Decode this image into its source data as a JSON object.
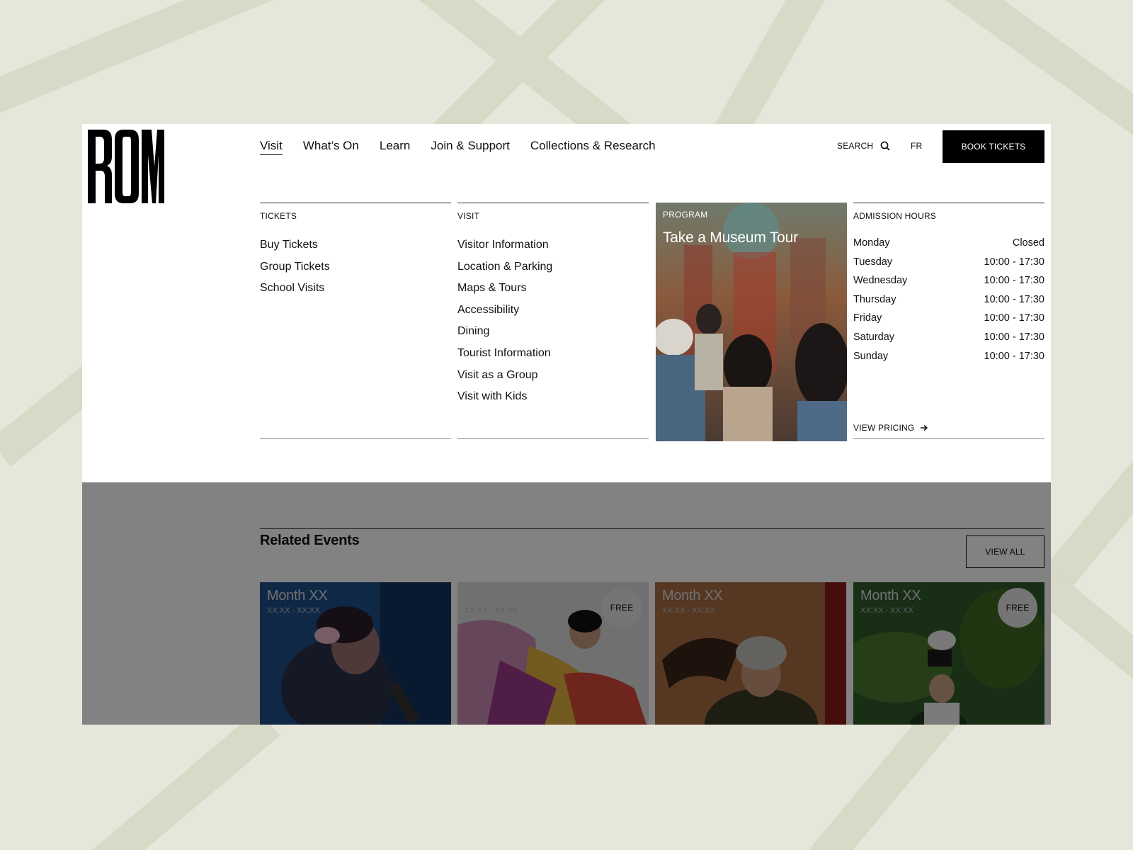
{
  "brand": {
    "logo_text": "ROM"
  },
  "nav": {
    "items": [
      {
        "label": "Visit",
        "active": true
      },
      {
        "label": "What’s On"
      },
      {
        "label": "Learn"
      },
      {
        "label": "Join & Support"
      },
      {
        "label": "Collections & Research"
      }
    ],
    "search_label": "SEARCH",
    "lang_label": "FR",
    "book_label": "BOOK TICKETS"
  },
  "menu": {
    "tickets": {
      "heading": "TICKETS",
      "links": [
        "Buy Tickets",
        "Group Tickets",
        "School Visits"
      ]
    },
    "visit": {
      "heading": "VISIT",
      "links": [
        "Visitor Information",
        "Location & Parking",
        "Maps & Tours",
        "Accessibility",
        "Dining",
        "Tourist Information",
        "Visit as a Group",
        "Visit with Kids"
      ]
    },
    "program": {
      "tag": "PROGRAM",
      "title": "Take a Museum Tour"
    },
    "hours": {
      "heading": "ADMISSION HOURS",
      "rows": [
        {
          "day": "Monday",
          "time": "Closed"
        },
        {
          "day": "Tuesday",
          "time": "10:00 - 17:30"
        },
        {
          "day": "Wednesday",
          "time": "10:00 - 17:30"
        },
        {
          "day": "Thursday",
          "time": "10:00 - 17:30"
        },
        {
          "day": "Friday",
          "time": "10:00 - 17:30"
        },
        {
          "day": "Saturday",
          "time": "10:00 - 17:30"
        },
        {
          "day": "Sunday",
          "time": "10:00 - 17:30"
        }
      ],
      "pricing_label": "VIEW PRICING"
    }
  },
  "related": {
    "title": "Related Events",
    "view_all_label": "VIEW ALL",
    "events": [
      {
        "month": "Month XX",
        "time": "XX:XX - XX:XX",
        "badge": ""
      },
      {
        "month": "Month XX",
        "time": "XX:XX - XX:XX",
        "badge": "FREE"
      },
      {
        "month": "Month XX",
        "time": "XX:XX - XX:XX",
        "badge": ""
      },
      {
        "month": "Month XX",
        "time": "XX:XX - XX:XX",
        "badge": "FREE"
      }
    ]
  },
  "colors": {
    "background": "#e6e6da",
    "primary_button": "#000000",
    "overlay": "rgba(0,0,0,0.49)"
  }
}
